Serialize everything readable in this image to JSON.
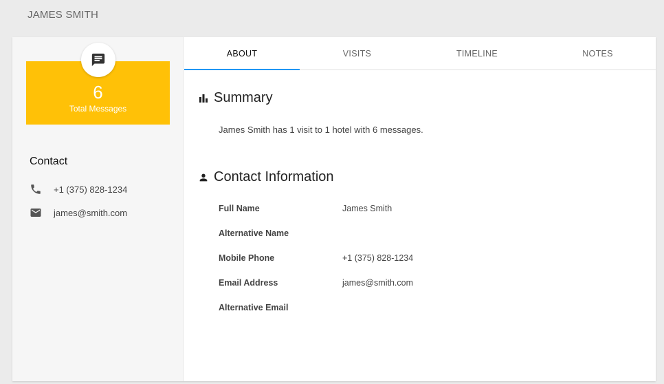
{
  "page": {
    "title": "JAMES SMITH"
  },
  "sidebar": {
    "messages": {
      "icon": "message-icon",
      "count": "6",
      "label": "Total Messages",
      "color": "#ffc107"
    },
    "contact": {
      "title": "Contact",
      "phone": {
        "icon": "phone-icon",
        "value": "+1 (375) 828-1234"
      },
      "email": {
        "icon": "email-icon",
        "value": "james@smith.com"
      }
    }
  },
  "tabs": [
    {
      "label": "ABOUT",
      "active": true
    },
    {
      "label": "VISITS",
      "active": false
    },
    {
      "label": "TIMELINE",
      "active": false
    },
    {
      "label": "NOTES",
      "active": false
    }
  ],
  "tab_accent": "#2196f3",
  "summary": {
    "icon": "bar-chart-icon",
    "heading": "Summary",
    "text": "James Smith has 1 visit to 1 hotel with 6 messages."
  },
  "contact_info": {
    "icon": "person-icon",
    "heading": "Contact Information",
    "fields": [
      {
        "label": "Full Name",
        "value": "James Smith"
      },
      {
        "label": "Alternative Name",
        "value": ""
      },
      {
        "label": "Mobile Phone",
        "value": "+1 (375) 828-1234"
      },
      {
        "label": "Email Address",
        "value": "james@smith.com"
      },
      {
        "label": "Alternative Email",
        "value": ""
      }
    ]
  }
}
